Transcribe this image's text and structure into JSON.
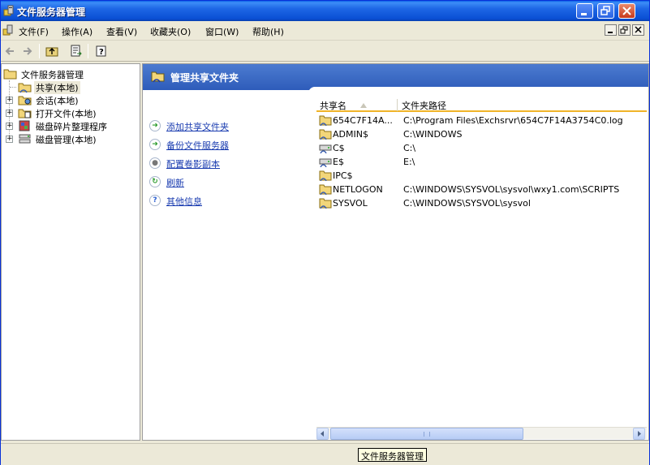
{
  "window": {
    "title": "文件服务器管理"
  },
  "menu": [
    "文件(F)",
    "操作(A)",
    "查看(V)",
    "收藏夹(O)",
    "窗口(W)",
    "帮助(H)"
  ],
  "tree": {
    "root": "文件服务器管理",
    "items": [
      "共享(本地)",
      "会话(本地)",
      "打开文件(本地)",
      "磁盘碎片整理程序",
      "磁盘管理(本地)"
    ]
  },
  "banner": {
    "title": "管理共享文件夹"
  },
  "tasks": [
    "添加共享文件夹",
    "备份文件服务器",
    "配置卷影副本",
    "刷新",
    "其他信息"
  ],
  "list": {
    "columns": [
      "共享名",
      "文件夹路径"
    ],
    "rows": [
      {
        "name": "654C7F14A...",
        "path": "C:\\Program Files\\Exchsrvr\\654C7F14A3754C0.log"
      },
      {
        "name": "ADMIN$",
        "path": "C:\\WINDOWS"
      },
      {
        "name": "C$",
        "path": "C:\\"
      },
      {
        "name": "E$",
        "path": "E:\\"
      },
      {
        "name": "IPC$",
        "path": ""
      },
      {
        "name": "NETLOGON",
        "path": "C:\\WINDOWS\\SYSVOL\\sysvol\\wxy1.com\\SCRIPTS"
      },
      {
        "name": "SYSVOL",
        "path": "C:\\WINDOWS\\SYSVOL\\sysvol"
      }
    ]
  },
  "tooltip": "文件服务器管理",
  "colors": {
    "titlebar": "#0a4fd4",
    "banner": "#3a68c4",
    "link": "#1a3cb0",
    "header_underline": "#f0b429"
  }
}
